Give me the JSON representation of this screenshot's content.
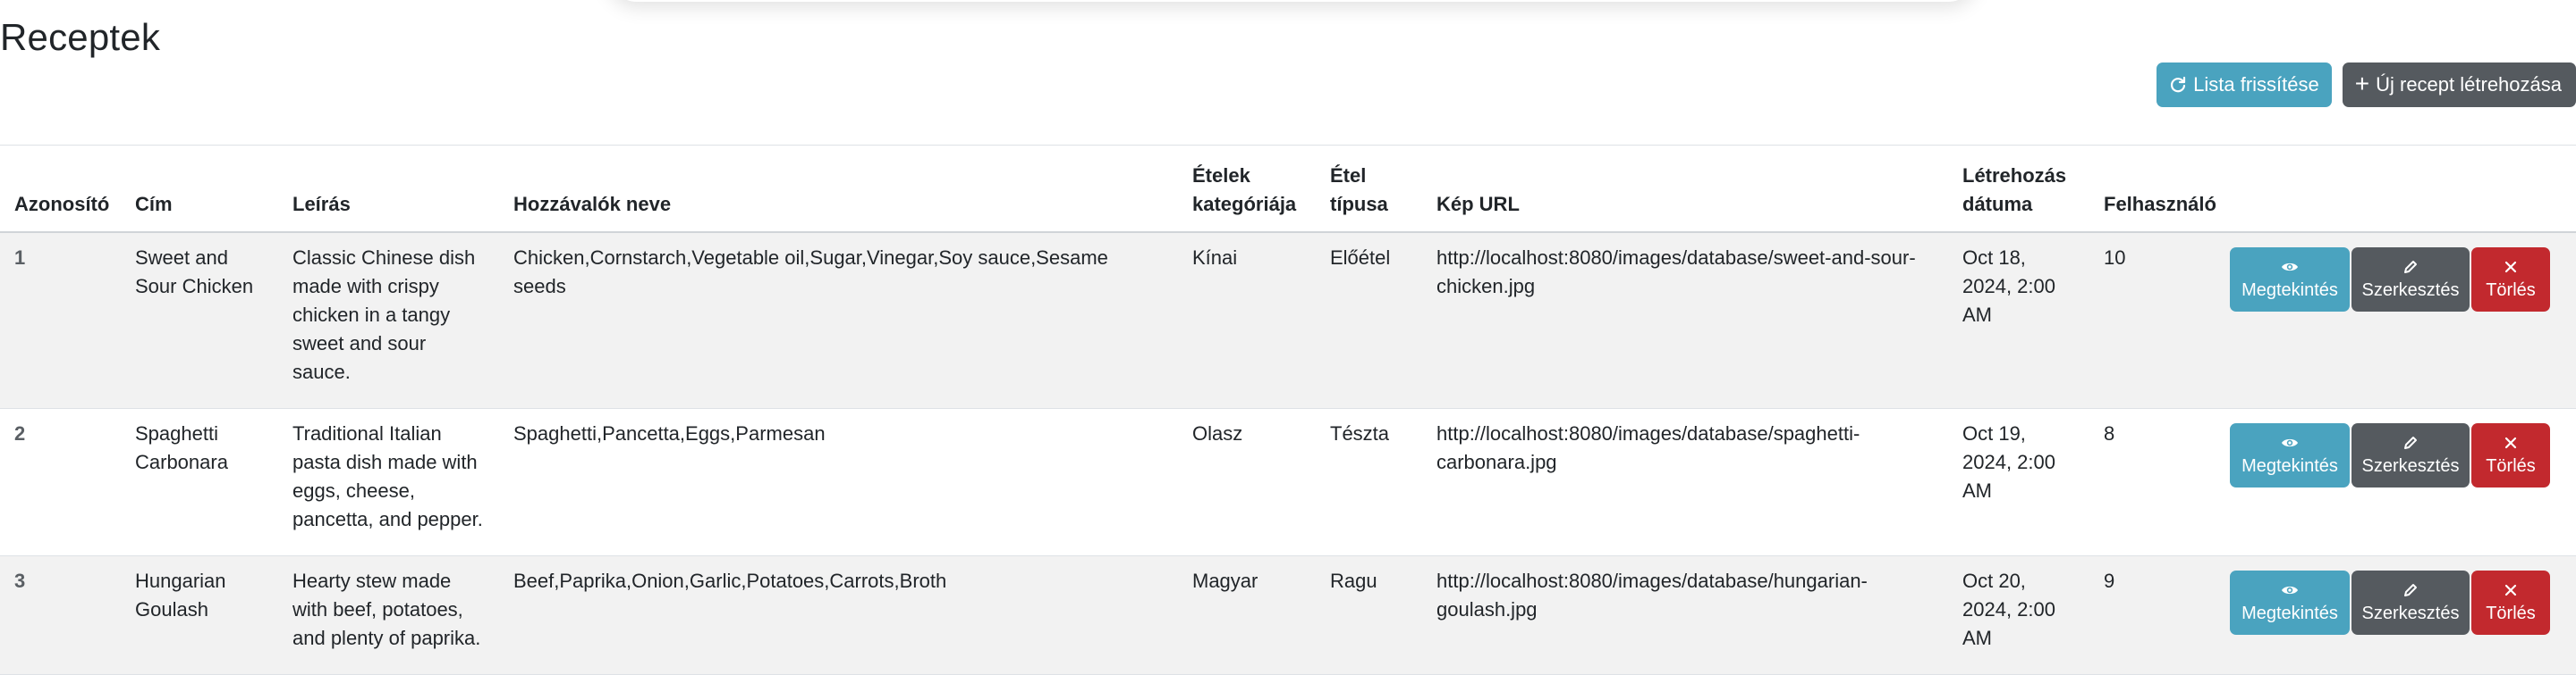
{
  "page": {
    "title": "Receptek"
  },
  "toolbar": {
    "refresh_label": "Lista frissítése",
    "create_label": "Új recept létrehozása"
  },
  "table": {
    "headers": {
      "id": "Azonosító",
      "title": "Cím",
      "description": "Leírás",
      "ingredients": "Hozzávalók neve",
      "category": "Ételek kategóriája",
      "type": "Étel típusa",
      "image_url": "Kép URL",
      "created": "Létrehozás dátuma",
      "user": "Felhasználó"
    },
    "rows": [
      {
        "id": "1",
        "title": "Sweet and Sour Chicken",
        "description": "Classic Chinese dish made with crispy chicken in a tangy sweet and sour sauce.",
        "ingredients": "Chicken,Cornstarch,Vegetable oil,Sugar,Vinegar,Soy sauce,Sesame seeds",
        "category": "Kínai",
        "type": "Előétel",
        "image_url": "http://localhost:8080/images/database/sweet-and-sour-chicken.jpg",
        "created": "Oct 18, 2024, 2:00 AM",
        "user": "10"
      },
      {
        "id": "2",
        "title": "Spaghetti Carbonara",
        "description": "Traditional Italian pasta dish made with eggs, cheese, pancetta, and pepper.",
        "ingredients": "Spaghetti,Pancetta,Eggs,Parmesan",
        "category": "Olasz",
        "type": "Tészta",
        "image_url": "http://localhost:8080/images/database/spaghetti-carbonara.jpg",
        "created": "Oct 19, 2024, 2:00 AM",
        "user": "8"
      },
      {
        "id": "3",
        "title": "Hungarian Goulash",
        "description": "Hearty stew made with beef, potatoes, and plenty of paprika.",
        "ingredients": "Beef,Paprika,Onion,Garlic,Potatoes,Carrots,Broth",
        "category": "Magyar",
        "type": "Ragu",
        "image_url": "http://localhost:8080/images/database/hungarian-goulash.jpg",
        "created": "Oct 20, 2024, 2:00 AM",
        "user": "9"
      }
    ]
  },
  "actions": {
    "view_label": "Megtekintés",
    "edit_label": "Szerkesztés",
    "delete_label": "Törlés"
  },
  "icons": {
    "refresh": "refresh-icon",
    "plus": "plus-icon",
    "view": "eye-icon",
    "edit": "pencil-icon",
    "delete": "x-icon"
  },
  "colors": {
    "info": "#4aa3bf",
    "secondary": "#555a5f",
    "danger": "#c2292e",
    "stripe": "#f2f2f2"
  }
}
